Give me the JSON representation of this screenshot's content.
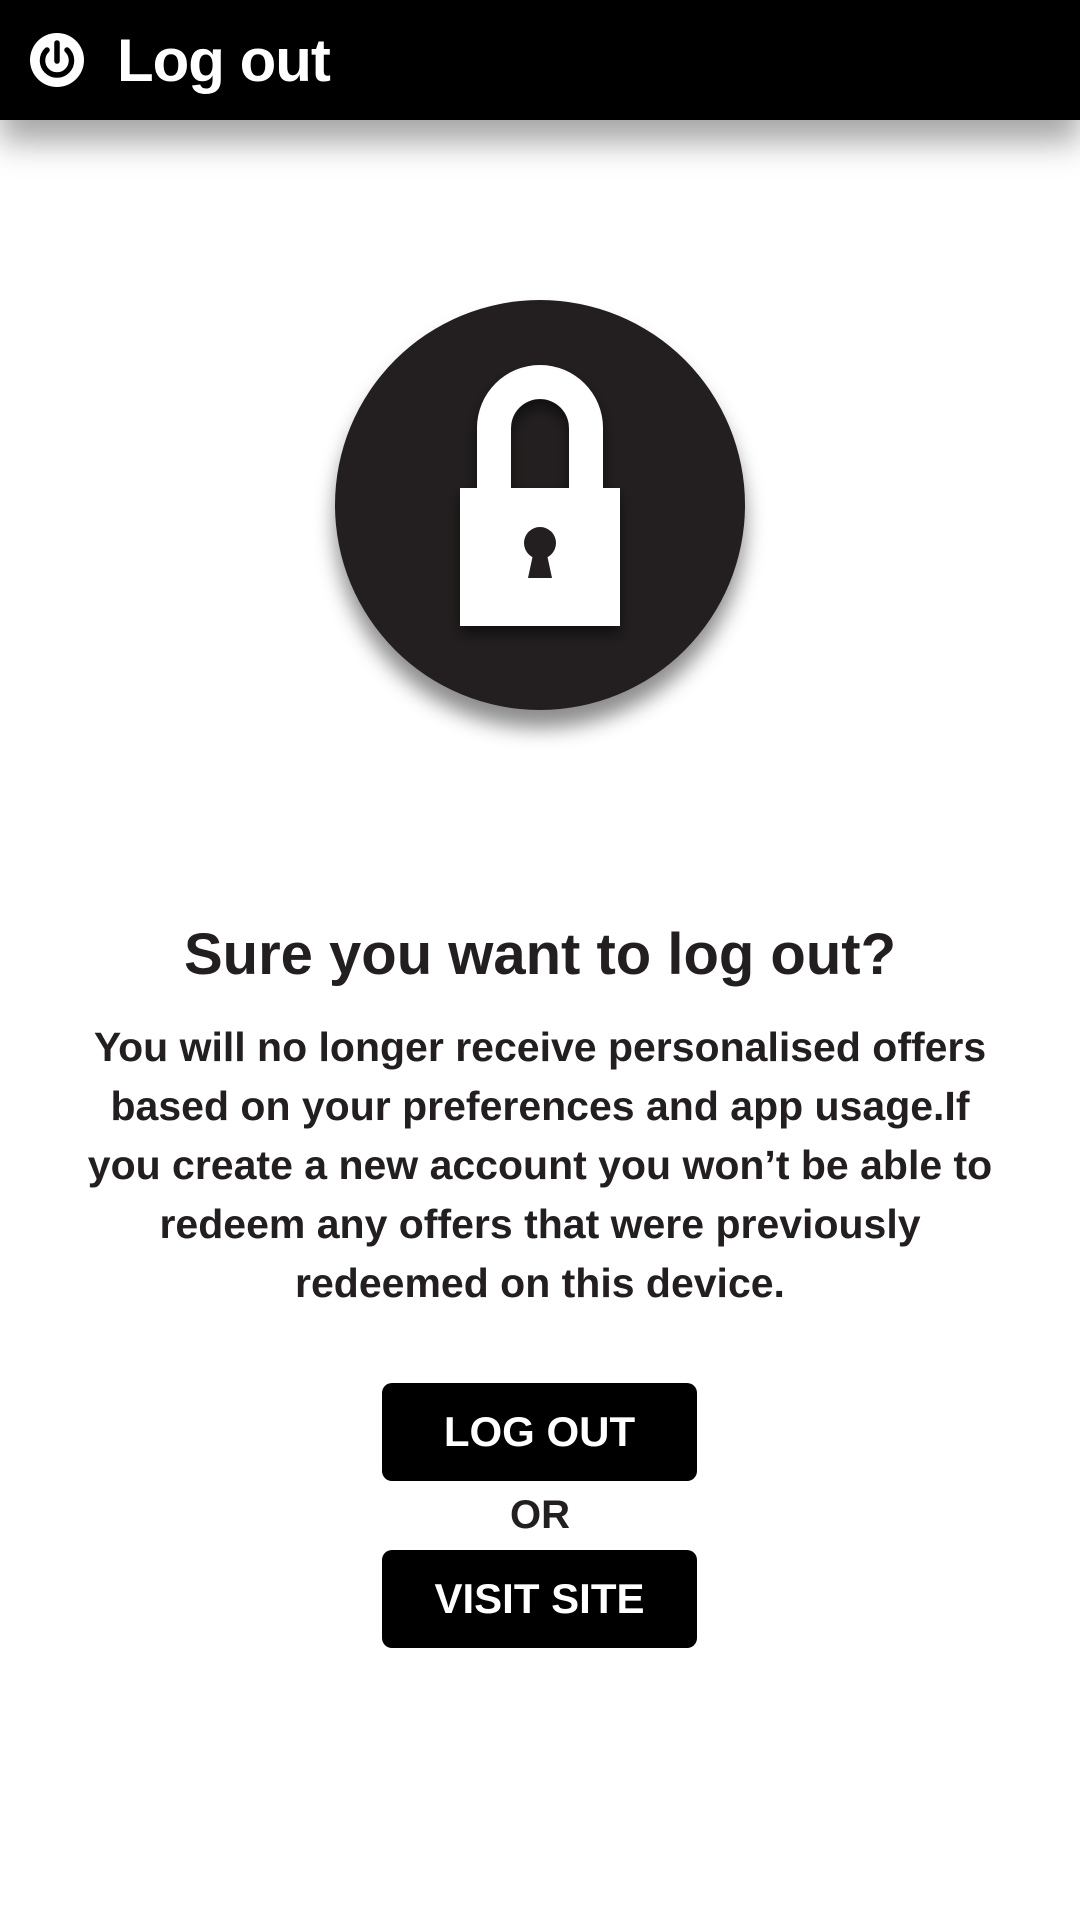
{
  "header": {
    "title": "Log out",
    "icon": "power-icon"
  },
  "hero": {
    "icon": "lock-icon",
    "circle_color": "#231f20"
  },
  "dialog": {
    "headline": "Sure you want to log out?",
    "message": "You will no longer receive personalised offers based on your preferences and app usage.If you create a new account you won’t be able to redeem any offers that were previously redeemed on this device."
  },
  "actions": {
    "logout_label": "LOG OUT",
    "separator": "OR",
    "visit_label": "VISIT SITE"
  },
  "colors": {
    "bar": "#000000",
    "text": "#231f20",
    "button": "#000000",
    "button_text": "#ffffff"
  }
}
